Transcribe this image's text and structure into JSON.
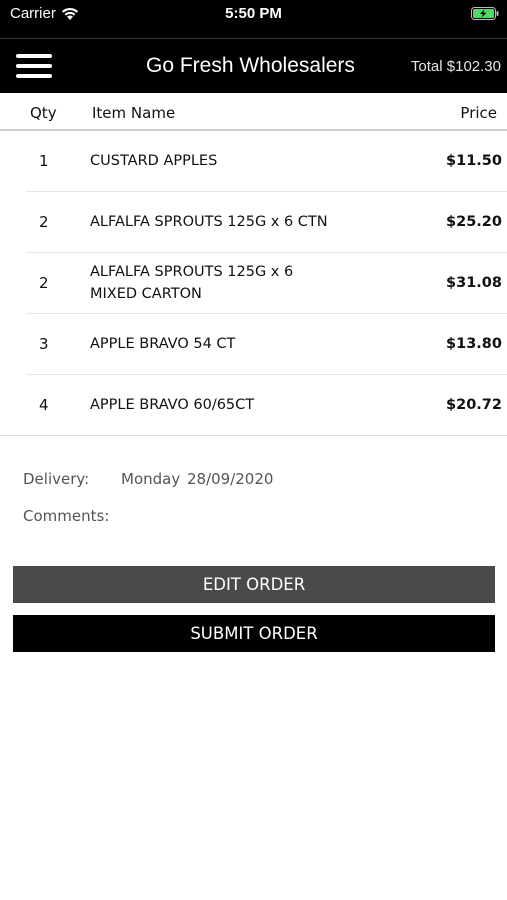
{
  "status_bar": {
    "carrier": "Carrier",
    "time": "5:50 PM",
    "battery_color": "#4cd964"
  },
  "nav": {
    "title": "Go Fresh Wholesalers",
    "total": "Total $102.30",
    "menu_icon": "hamburger-menu-icon"
  },
  "table": {
    "headers": {
      "qty": "Qty",
      "item_name": "Item Name",
      "price": "Price"
    },
    "rows": [
      {
        "qty": "1",
        "name": "CUSTARD APPLES",
        "price": "$11.50"
      },
      {
        "qty": "2",
        "name": "ALFALFA SPROUTS 125G x 6 CTN",
        "price": "$25.20"
      },
      {
        "qty": "2",
        "name": "ALFALFA SPROUTS 125G x 6 MIXED CARTON",
        "price": "$31.08"
      },
      {
        "qty": "3",
        "name": "APPLE BRAVO 54 CT",
        "price": "$13.80"
      },
      {
        "qty": "4",
        "name": "APPLE BRAVO 60/65CT",
        "price": "$20.72"
      }
    ]
  },
  "order_info": {
    "delivery_label": "Delivery:",
    "delivery_value": "Monday  28/09/2020",
    "comments_label": "Comments:"
  },
  "buttons": {
    "edit": "EDIT ORDER",
    "submit": "SUBMIT ORDER"
  }
}
